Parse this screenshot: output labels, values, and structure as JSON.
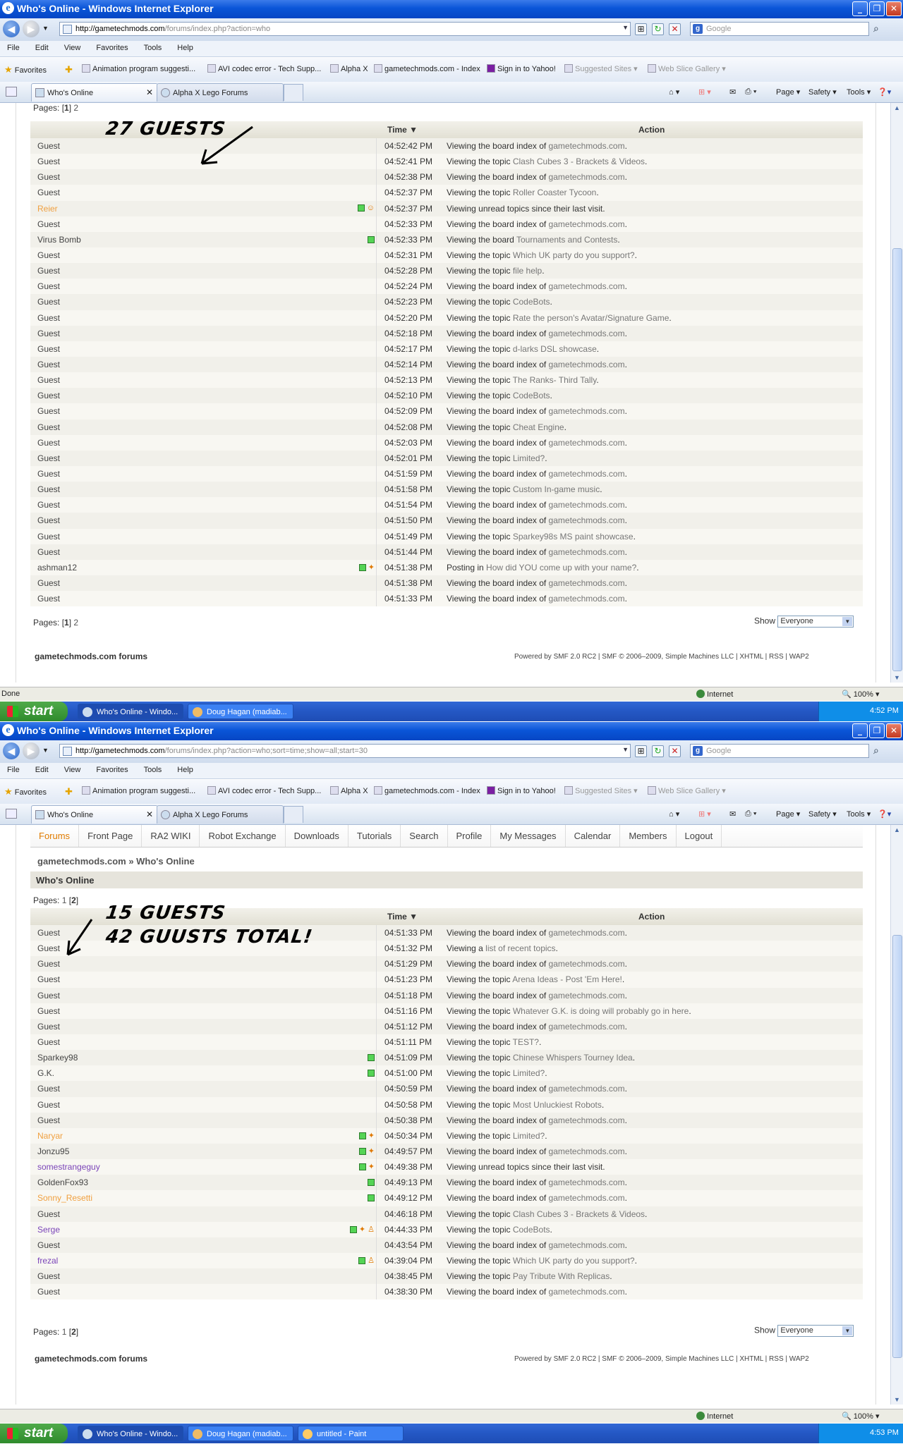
{
  "browser": {
    "title": "Who's Online - Windows Internet Explorer",
    "menus": [
      "File",
      "Edit",
      "View",
      "Favorites",
      "Tools",
      "Help"
    ],
    "search_placeholder": "Google",
    "favorites_label": "Favorites",
    "favorites": [
      "Animation program suggesti...",
      "AVI codec error - Tech Supp...",
      "Alpha X",
      "gametechmods.com - Index",
      "Sign in to Yahoo!",
      "Suggested Sites ▾",
      "Web Slice Gallery ▾"
    ],
    "tabs": [
      "Who's Online",
      "Alpha X Lego Forums"
    ],
    "commands": {
      "page": "Page ▾",
      "safety": "Safety ▾",
      "tools": "Tools ▾"
    },
    "status_done": "Done",
    "zone": "Internet",
    "zoom": "100%"
  },
  "shot1": {
    "url_host": "http://gametechmods.com",
    "url_path": "/forums/index.php?action=who",
    "pages_label": "Pages: [",
    "pages_current": "1",
    "pages_other": "2",
    "annotation": "27 GUESTS",
    "clock": "4:52 PM",
    "rows": [
      {
        "name": "Guest",
        "type": "guest",
        "icons": "",
        "time": "04:52:42 PM",
        "pre": "Viewing the board index of ",
        "link": "gametechmods.com",
        "post": "."
      },
      {
        "name": "Guest",
        "type": "guest",
        "icons": "",
        "time": "04:52:41 PM",
        "pre": "Viewing the topic ",
        "link": "Clash Cubes 3 - Brackets & Videos",
        "post": "."
      },
      {
        "name": "Guest",
        "type": "guest",
        "icons": "",
        "time": "04:52:38 PM",
        "pre": "Viewing the board index of ",
        "link": "gametechmods.com",
        "post": "."
      },
      {
        "name": "Guest",
        "type": "guest",
        "icons": "",
        "time": "04:52:37 PM",
        "pre": "Viewing the topic ",
        "link": "Roller Coaster Tycoon",
        "post": "."
      },
      {
        "name": "Reier",
        "type": "mod",
        "icons": "dot,smile",
        "time": "04:52:37 PM",
        "pre": "Viewing unread topics since their last visit.",
        "link": "",
        "post": ""
      },
      {
        "name": "Guest",
        "type": "guest",
        "icons": "",
        "time": "04:52:33 PM",
        "pre": "Viewing the board index of ",
        "link": "gametechmods.com",
        "post": "."
      },
      {
        "name": "Virus Bomb",
        "type": "member",
        "icons": "dot",
        "time": "04:52:33 PM",
        "pre": "Viewing the board ",
        "link": "Tournaments and Contests",
        "post": "."
      },
      {
        "name": "Guest",
        "type": "guest",
        "icons": "",
        "time": "04:52:31 PM",
        "pre": "Viewing the topic ",
        "link": "Which UK party do you support?",
        "post": "."
      },
      {
        "name": "Guest",
        "type": "guest",
        "icons": "",
        "time": "04:52:28 PM",
        "pre": "Viewing the topic ",
        "link": "file help",
        "post": "."
      },
      {
        "name": "Guest",
        "type": "guest",
        "icons": "",
        "time": "04:52:24 PM",
        "pre": "Viewing the board index of ",
        "link": "gametechmods.com",
        "post": "."
      },
      {
        "name": "Guest",
        "type": "guest",
        "icons": "",
        "time": "04:52:23 PM",
        "pre": "Viewing the topic ",
        "link": "CodeBots",
        "post": "."
      },
      {
        "name": "Guest",
        "type": "guest",
        "icons": "",
        "time": "04:52:20 PM",
        "pre": "Viewing the topic ",
        "link": "Rate the person's Avatar/Signature Game",
        "post": "."
      },
      {
        "name": "Guest",
        "type": "guest",
        "icons": "",
        "time": "04:52:18 PM",
        "pre": "Viewing the board index of ",
        "link": "gametechmods.com",
        "post": "."
      },
      {
        "name": "Guest",
        "type": "guest",
        "icons": "",
        "time": "04:52:17 PM",
        "pre": "Viewing the topic ",
        "link": "d-larks DSL showcase",
        "post": "."
      },
      {
        "name": "Guest",
        "type": "guest",
        "icons": "",
        "time": "04:52:14 PM",
        "pre": "Viewing the board index of ",
        "link": "gametechmods.com",
        "post": "."
      },
      {
        "name": "Guest",
        "type": "guest",
        "icons": "",
        "time": "04:52:13 PM",
        "pre": "Viewing the topic ",
        "link": "The Ranks- Third Tally",
        "post": "."
      },
      {
        "name": "Guest",
        "type": "guest",
        "icons": "",
        "time": "04:52:10 PM",
        "pre": "Viewing the topic ",
        "link": "CodeBots",
        "post": "."
      },
      {
        "name": "Guest",
        "type": "guest",
        "icons": "",
        "time": "04:52:09 PM",
        "pre": "Viewing the board index of ",
        "link": "gametechmods.com",
        "post": "."
      },
      {
        "name": "Guest",
        "type": "guest",
        "icons": "",
        "time": "04:52:08 PM",
        "pre": "Viewing the topic ",
        "link": "Cheat Engine",
        "post": "."
      },
      {
        "name": "Guest",
        "type": "guest",
        "icons": "",
        "time": "04:52:03 PM",
        "pre": "Viewing the board index of ",
        "link": "gametechmods.com",
        "post": "."
      },
      {
        "name": "Guest",
        "type": "guest",
        "icons": "",
        "time": "04:52:01 PM",
        "pre": "Viewing the topic ",
        "link": "Limited?",
        "post": "."
      },
      {
        "name": "Guest",
        "type": "guest",
        "icons": "",
        "time": "04:51:59 PM",
        "pre": "Viewing the board index of ",
        "link": "gametechmods.com",
        "post": "."
      },
      {
        "name": "Guest",
        "type": "guest",
        "icons": "",
        "time": "04:51:58 PM",
        "pre": "Viewing the topic ",
        "link": "Custom In-game music",
        "post": "."
      },
      {
        "name": "Guest",
        "type": "guest",
        "icons": "",
        "time": "04:51:54 PM",
        "pre": "Viewing the board index of ",
        "link": "gametechmods.com",
        "post": "."
      },
      {
        "name": "Guest",
        "type": "guest",
        "icons": "",
        "time": "04:51:50 PM",
        "pre": "Viewing the board index of ",
        "link": "gametechmods.com",
        "post": "."
      },
      {
        "name": "Guest",
        "type": "guest",
        "icons": "",
        "time": "04:51:49 PM",
        "pre": "Viewing the topic ",
        "link": "Sparkey98s MS paint showcase",
        "post": "."
      },
      {
        "name": "Guest",
        "type": "guest",
        "icons": "",
        "time": "04:51:44 PM",
        "pre": "Viewing the board index of ",
        "link": "gametechmods.com",
        "post": "."
      },
      {
        "name": "ashman12",
        "type": "guestlike",
        "icons": "dot,ff",
        "time": "04:51:38 PM",
        "pre": "Posting in ",
        "link": "How did YOU come up with your name?",
        "post": "."
      },
      {
        "name": "Guest",
        "type": "guest",
        "icons": "",
        "time": "04:51:38 PM",
        "pre": "Viewing the board index of ",
        "link": "gametechmods.com",
        "post": "."
      },
      {
        "name": "Guest",
        "type": "guest",
        "icons": "",
        "time": "04:51:33 PM",
        "pre": "Viewing the board index of ",
        "link": "gametechmods.com",
        "post": "."
      }
    ],
    "tasks": [
      "Who's Online - Windo...",
      "Doug Hagan (madiab..."
    ]
  },
  "shot2": {
    "url_host": "http://gametechmods.com",
    "url_path": "/forums/index.php?action=who;sort=time;show=all;start=30",
    "nav": [
      "Forums",
      "Front Page",
      "RA2 WIKI",
      "Robot Exchange",
      "Downloads",
      "Tutorials",
      "Search",
      "Profile",
      "My Messages",
      "Calendar",
      "Members",
      "Logout"
    ],
    "breadcrumb": "gametechmods.com » Who's Online",
    "heading": "Who's Online",
    "pages_label": "Pages: ",
    "pages_other": "1",
    "pages_current": "2",
    "annotation1": "15 GUESTS",
    "annotation2": "42 GUUSTS TOTAL!",
    "clock": "4:53 PM",
    "rows": [
      {
        "name": "Guest",
        "type": "guest",
        "icons": "",
        "time": "04:51:33 PM",
        "pre": "Viewing the board index of ",
        "link": "gametechmods.com",
        "post": "."
      },
      {
        "name": "Guest",
        "type": "guest",
        "icons": "",
        "time": "04:51:32 PM",
        "pre": "Viewing a ",
        "link": "list of recent topics",
        "post": "."
      },
      {
        "name": "Guest",
        "type": "guest",
        "icons": "",
        "time": "04:51:29 PM",
        "pre": "Viewing the board index of ",
        "link": "gametechmods.com",
        "post": "."
      },
      {
        "name": "Guest",
        "type": "guest",
        "icons": "",
        "time": "04:51:23 PM",
        "pre": "Viewing the topic ",
        "link": "Arena Ideas - Post 'Em Here!",
        "post": "."
      },
      {
        "name": "Guest",
        "type": "guest",
        "icons": "",
        "time": "04:51:18 PM",
        "pre": "Viewing the board index of ",
        "link": "gametechmods.com",
        "post": "."
      },
      {
        "name": "Guest",
        "type": "guest",
        "icons": "",
        "time": "04:51:16 PM",
        "pre": "Viewing the topic ",
        "link": "Whatever G.K. is doing will probably go in here",
        "post": "."
      },
      {
        "name": "Guest",
        "type": "guest",
        "icons": "",
        "time": "04:51:12 PM",
        "pre": "Viewing the board index of ",
        "link": "gametechmods.com",
        "post": "."
      },
      {
        "name": "Guest",
        "type": "guest",
        "icons": "",
        "time": "04:51:11 PM",
        "pre": "Viewing the topic ",
        "link": "TEST?",
        "post": "."
      },
      {
        "name": "Sparkey98",
        "type": "member",
        "icons": "dot",
        "time": "04:51:09 PM",
        "pre": "Viewing the topic ",
        "link": "Chinese Whispers Tourney Idea",
        "post": "."
      },
      {
        "name": "G.K.",
        "type": "member",
        "icons": "dot",
        "time": "04:51:00 PM",
        "pre": "Viewing the topic ",
        "link": "Limited?",
        "post": "."
      },
      {
        "name": "Guest",
        "type": "guest",
        "icons": "",
        "time": "04:50:59 PM",
        "pre": "Viewing the board index of ",
        "link": "gametechmods.com",
        "post": "."
      },
      {
        "name": "Guest",
        "type": "guest",
        "icons": "",
        "time": "04:50:58 PM",
        "pre": "Viewing the topic ",
        "link": "Most Unluckiest Robots",
        "post": "."
      },
      {
        "name": "Guest",
        "type": "guest",
        "icons": "",
        "time": "04:50:38 PM",
        "pre": "Viewing the board index of ",
        "link": "gametechmods.com",
        "post": "."
      },
      {
        "name": "Naryar",
        "type": "mod",
        "icons": "dot,ff",
        "time": "04:50:34 PM",
        "pre": "Viewing the topic ",
        "link": "Limited?",
        "post": "."
      },
      {
        "name": "Jonzu95",
        "type": "member",
        "icons": "dot,ff",
        "time": "04:49:57 PM",
        "pre": "Viewing the board index of ",
        "link": "gametechmods.com",
        "post": "."
      },
      {
        "name": "somestrangeguy",
        "type": "purple",
        "icons": "dot,ff",
        "time": "04:49:38 PM",
        "pre": "Viewing unread topics since their last visit.",
        "link": "",
        "post": ""
      },
      {
        "name": "GoldenFox93",
        "type": "member",
        "icons": "dot",
        "time": "04:49:13 PM",
        "pre": "Viewing the board index of ",
        "link": "gametechmods.com",
        "post": "."
      },
      {
        "name": "Sonny_Resetti",
        "type": "mod",
        "icons": "dot",
        "time": "04:49:12 PM",
        "pre": "Viewing the board index of ",
        "link": "gametechmods.com",
        "post": "."
      },
      {
        "name": "Guest",
        "type": "guest",
        "icons": "",
        "time": "04:46:18 PM",
        "pre": "Viewing the topic ",
        "link": "Clash Cubes 3 - Brackets & Videos",
        "post": "."
      },
      {
        "name": "Serge",
        "type": "purple",
        "icons": "dot,ff,walk",
        "time": "04:44:33 PM",
        "pre": "Viewing the topic ",
        "link": "CodeBots",
        "post": "."
      },
      {
        "name": "Guest",
        "type": "guest",
        "icons": "",
        "time": "04:43:54 PM",
        "pre": "Viewing the board index of ",
        "link": "gametechmods.com",
        "post": "."
      },
      {
        "name": "frezal",
        "type": "purple",
        "icons": "dot,walk",
        "time": "04:39:04 PM",
        "pre": "Viewing the topic ",
        "link": "Which UK party do you support?",
        "post": "."
      },
      {
        "name": "Guest",
        "type": "guest",
        "icons": "",
        "time": "04:38:45 PM",
        "pre": "Viewing the topic ",
        "link": "Pay Tribute With Replicas",
        "post": "."
      },
      {
        "name": "Guest",
        "type": "guest",
        "icons": "",
        "time": "04:38:30 PM",
        "pre": "Viewing the board index of ",
        "link": "gametechmods.com",
        "post": "."
      }
    ],
    "tasks": [
      "Who's Online - Windo...",
      "Doug Hagan (madiab...",
      "untitled - Paint"
    ]
  },
  "table": {
    "time_header": "Time",
    "action_header": "Action"
  },
  "show_label": "Show",
  "show_value": "Everyone",
  "footer_left": "gametechmods.com forums",
  "footer_right": "Powered by SMF 2.0 RC2 | SMF © 2006–2009, Simple Machines LLC | XHTML | RSS | WAP2",
  "start_label": "start",
  "colors": {
    "xp_blue": "#0a55d8",
    "mod_orange": "#f0a040",
    "member_purple": "#7a44b8",
    "link_gray": "#777777"
  }
}
